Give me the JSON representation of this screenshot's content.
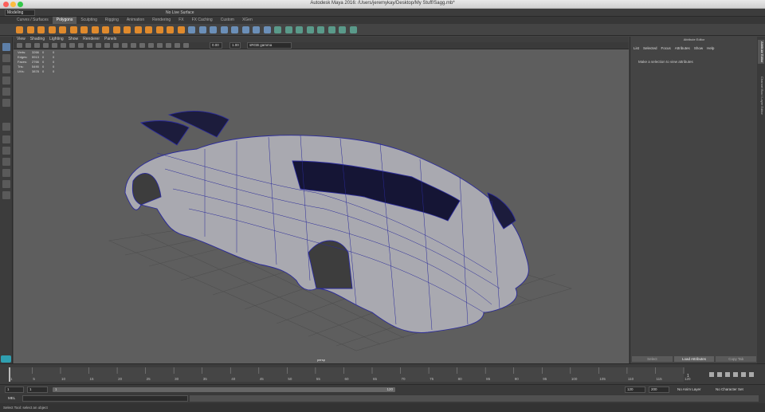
{
  "window": {
    "title": "Autodesk Maya 2016: /Users/jeremykay/Desktop/My Stuff/Sagg.mb*"
  },
  "menubar": {
    "mode": "Modeling",
    "no_live_surface": "No Live Surface"
  },
  "shelf_tabs": [
    "Curves / Surfaces",
    "Polygons",
    "Sculpting",
    "Rigging",
    "Animation",
    "Rendering",
    "FX",
    "FX Caching",
    "Custom",
    "XGen"
  ],
  "shelf_active": "Polygons",
  "viewport": {
    "menu": [
      "View",
      "Shading",
      "Lighting",
      "Show",
      "Renderer",
      "Panels"
    ],
    "toolbar": {
      "gamma_value": "0.00",
      "exposure_value": "1.00",
      "colorspace": "sRGB gamma"
    },
    "hud": [
      {
        "label": "Verts:",
        "v1": "3266",
        "v2": "0",
        "v3": "0"
      },
      {
        "label": "Edges:",
        "v1": "5913",
        "v2": "0",
        "v3": "0"
      },
      {
        "label": "Faces:",
        "v1": "2766",
        "v2": "0",
        "v3": "0"
      },
      {
        "label": "Tris:",
        "v1": "5490",
        "v2": "0",
        "v3": "0"
      },
      {
        "label": "UVs:",
        "v1": "3878",
        "v2": "0",
        "v3": "0"
      }
    ],
    "camera_label": "persp"
  },
  "attribute_editor": {
    "title": "Attribute Editor",
    "menu": [
      "List",
      "Selected",
      "Focus",
      "Attributes",
      "Show",
      "Help"
    ],
    "message": "Make a selection to view attributes",
    "buttons": [
      "Select",
      "Load Attributes",
      "Copy Tab"
    ]
  },
  "side_tabs": [
    "Attribute Editor",
    "Channel Box / Layer Editor"
  ],
  "timeline": {
    "ticks": [
      "1",
      "5",
      "10",
      "15",
      "20",
      "25",
      "30",
      "35",
      "40",
      "45",
      "50",
      "55",
      "60",
      "65",
      "70",
      "75",
      "80",
      "85",
      "90",
      "95",
      "100",
      "105",
      "110",
      "115",
      "120"
    ],
    "current": "1"
  },
  "range": {
    "start": "1",
    "inner_start": "1",
    "slider_start": "1",
    "slider_end": "120",
    "end": "120",
    "anim_end": "200",
    "anim_layer": "No Anim Layer",
    "char_set": "No Character Set"
  },
  "command": {
    "lang": "MEL"
  },
  "help": {
    "text": "Select Tool: select an object"
  },
  "colors": {
    "accent": "#5d7fa8",
    "mesh_wire": "#2a2a9a",
    "mesh_fill": "#a9a9b0"
  }
}
